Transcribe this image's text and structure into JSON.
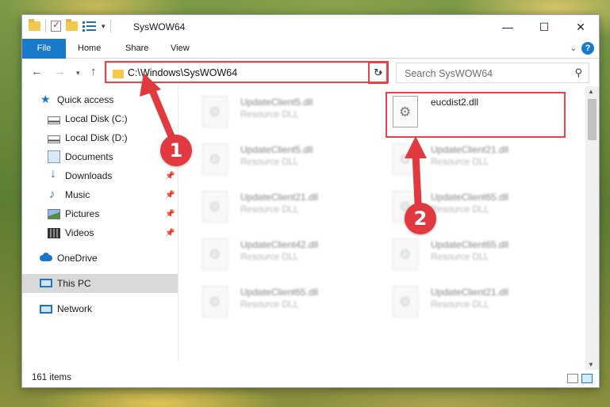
{
  "window": {
    "title": "SysWOW64",
    "minimize_icon": "—",
    "maximize_icon": "☐",
    "close_icon": "✕"
  },
  "ribbon": {
    "tabs": [
      "File",
      "Home",
      "Share",
      "View"
    ],
    "help_label": "?"
  },
  "address_bar": {
    "path": "C:\\Windows\\SysWOW64",
    "back_icon": "←",
    "forward_icon": "→",
    "recent_icon": "▾",
    "up_icon": "↑",
    "refresh_icon": "↻"
  },
  "search": {
    "placeholder": "Search SysWOW64"
  },
  "sidebar": {
    "items": [
      {
        "label": "Quick access",
        "icon": "star-icon"
      },
      {
        "label": "Local Disk (C:)",
        "icon": "disk-icon"
      },
      {
        "label": "Local Disk (D:)",
        "icon": "disk-icon"
      },
      {
        "label": "Documents",
        "icon": "documents-icon"
      },
      {
        "label": "Downloads",
        "icon": "downloads-icon"
      },
      {
        "label": "Music",
        "icon": "music-icon"
      },
      {
        "label": "Pictures",
        "icon": "pictures-icon"
      },
      {
        "label": "Videos",
        "icon": "videos-icon"
      },
      {
        "label": "OneDrive",
        "icon": "cloud-icon"
      },
      {
        "label": "This PC",
        "icon": "pc-icon"
      },
      {
        "label": "Network",
        "icon": "network-icon"
      }
    ]
  },
  "files": [
    {
      "name": "UpdateClient5.dll",
      "type": "Resource DLL"
    },
    {
      "name": "eucdist2.dll",
      "type": ""
    },
    {
      "name": "UpdateClient5.dll",
      "type": "Resource DLL"
    },
    {
      "name": "UpdateClient21.dll",
      "type": "Resource DLL"
    },
    {
      "name": "UpdateClient21.dll",
      "type": "Resource DLL"
    },
    {
      "name": "UpdateClient65.dll",
      "type": "Resource DLL"
    },
    {
      "name": "UpdateClient42.dll",
      "type": "Resource DLL"
    },
    {
      "name": "UpdateClient65.dll",
      "type": "Resource DLL"
    },
    {
      "name": "UpdateClient65.dll",
      "type": "Resource DLL"
    },
    {
      "name": "UpdateClient21.dll",
      "type": "Resource DLL"
    }
  ],
  "status": {
    "item_count": "161 items"
  },
  "annotations": {
    "step1": "1",
    "step2": "2",
    "color": "#e0393f"
  }
}
